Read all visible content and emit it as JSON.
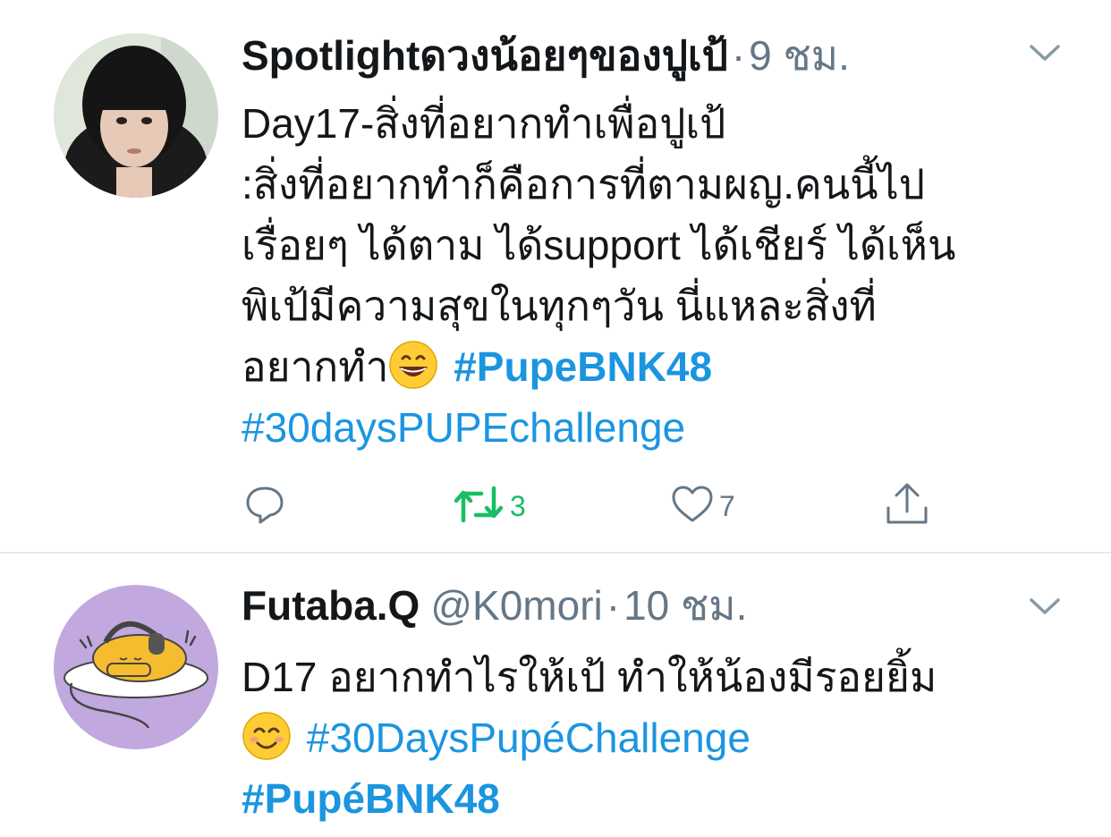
{
  "colors": {
    "text": "#14171a",
    "secondary": "#657786",
    "link": "#1b95e0",
    "retweet_active": "#17bf63",
    "divider": "#e6ecf0"
  },
  "tweets": [
    {
      "display_name": "Spotlightดวงน้อยๆของปูเป้",
      "handle": "",
      "separator": "·",
      "time": "9 ชม.",
      "lines": [
        "Day17-สิ่งที่อยากทำเพื่อปูเป้",
        ":สิ่งที่อยากทำก็คือการที่ตามผญ.คนนี้ไป",
        "เรื่อยๆ ได้ตาม ได้support ได้เชียร์ ได้เห็น",
        "พิเป้มีความสุขในทุกๆวัน นี่แหละสิ่งที่",
        "อยากทำ"
      ],
      "hashtags": [
        "#PupeBNK48",
        "#30daysPUPEchallenge"
      ],
      "emoji": "grinning-face-emoji",
      "actions": {
        "reply_icon": "reply-icon",
        "retweet_icon": "retweet-icon",
        "retweet_count": "3",
        "like_icon": "heart-icon",
        "like_count": "7",
        "share_icon": "share-icon"
      }
    },
    {
      "display_name": "Futaba.Q",
      "handle": "@K0mori",
      "separator": "·",
      "time": "10 ชม.",
      "lines": [
        "D17 อยากทำไรให้เป้ ทำให้น้องมีรอยยิ้ม"
      ],
      "hashtags": [
        "#30DaysPupéChallenge",
        "#PupéBNK48"
      ],
      "emoji": "smiling-face-emoji"
    }
  ]
}
